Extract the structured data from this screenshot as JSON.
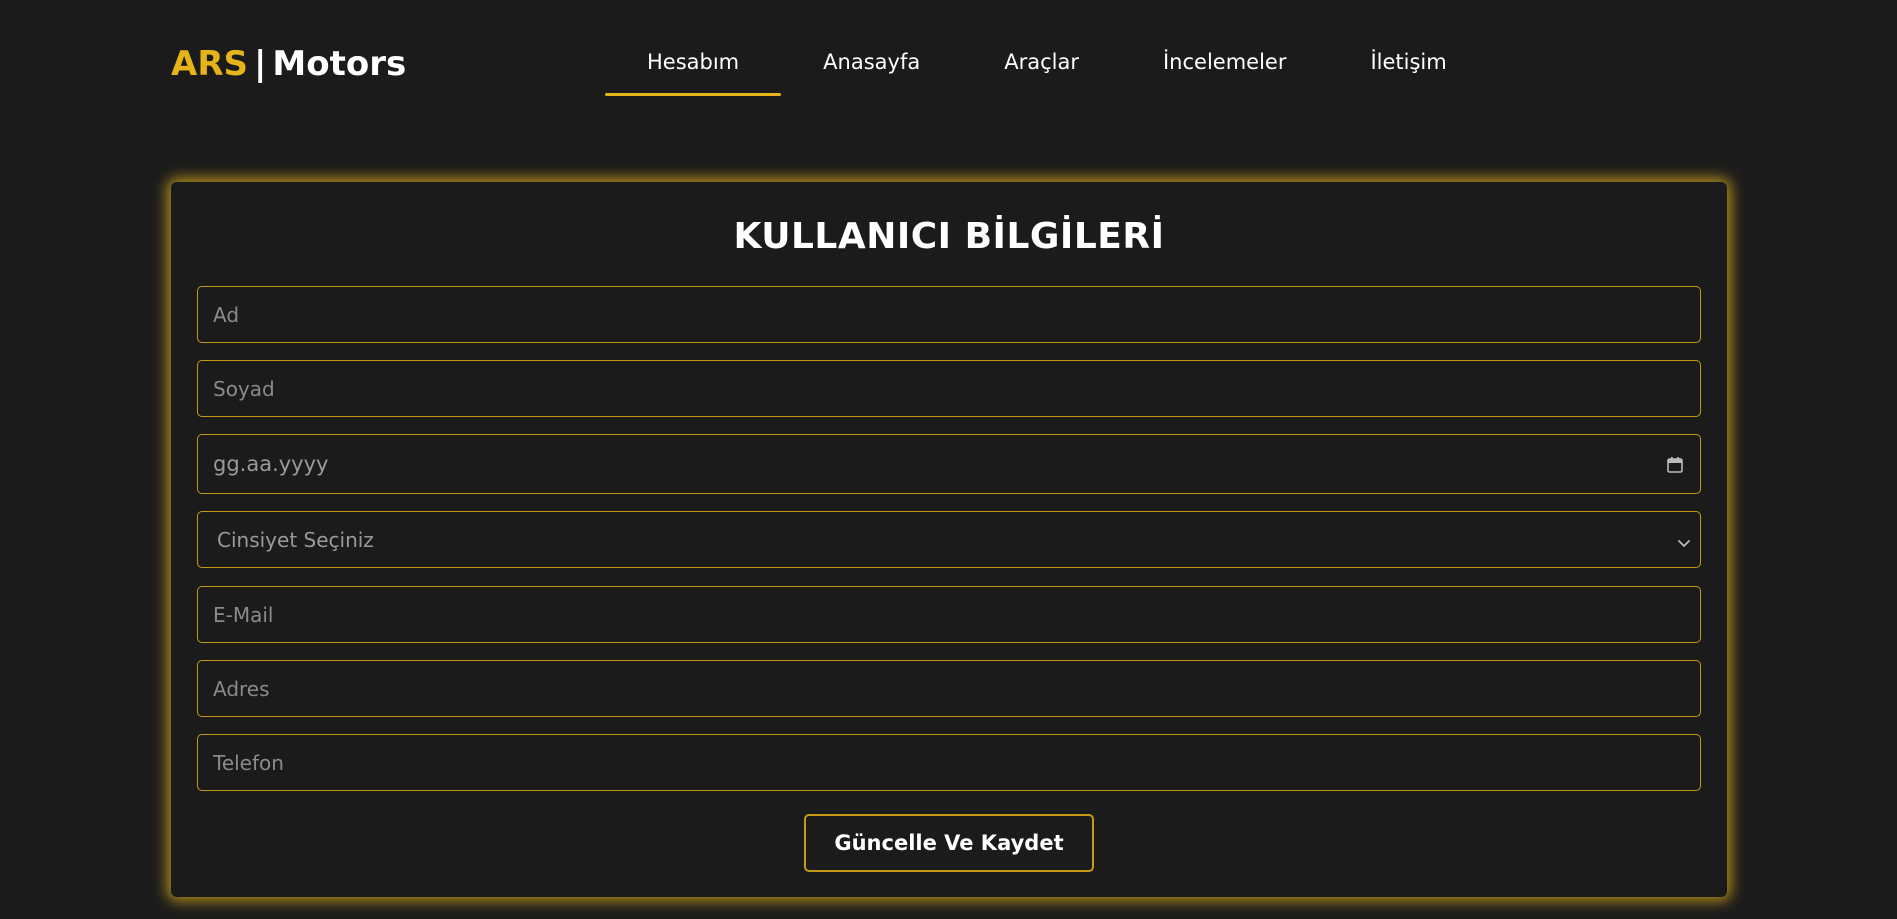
{
  "logo": {
    "brand": "ARS",
    "separator": "|",
    "rest": "Motors"
  },
  "nav": {
    "items": [
      {
        "label": "Hesabım",
        "active": true
      },
      {
        "label": "Anasayfa",
        "active": false
      },
      {
        "label": "Araçlar",
        "active": false
      },
      {
        "label": "İncelemeler",
        "active": false
      },
      {
        "label": "İletişim",
        "active": false
      }
    ]
  },
  "form": {
    "title": "KULLANICI BİLGİLERİ",
    "ad_placeholder": "Ad",
    "soyad_placeholder": "Soyad",
    "date_placeholder": "gg.aa.yyyy",
    "gender_selected": "Cinsiyet Seçiniz",
    "email_placeholder": "E-Mail",
    "adres_placeholder": "Adres",
    "telefon_placeholder": "Telefon",
    "submit_label": "Güncelle Ve Kaydet"
  },
  "icons": {
    "date_picker": "calendar-icon",
    "select": "chevron-down-icon"
  },
  "colors": {
    "accent": "#e4b419",
    "background": "#1b1b1b",
    "text": "#ffffff",
    "placeholder": "#8a8a8a"
  }
}
